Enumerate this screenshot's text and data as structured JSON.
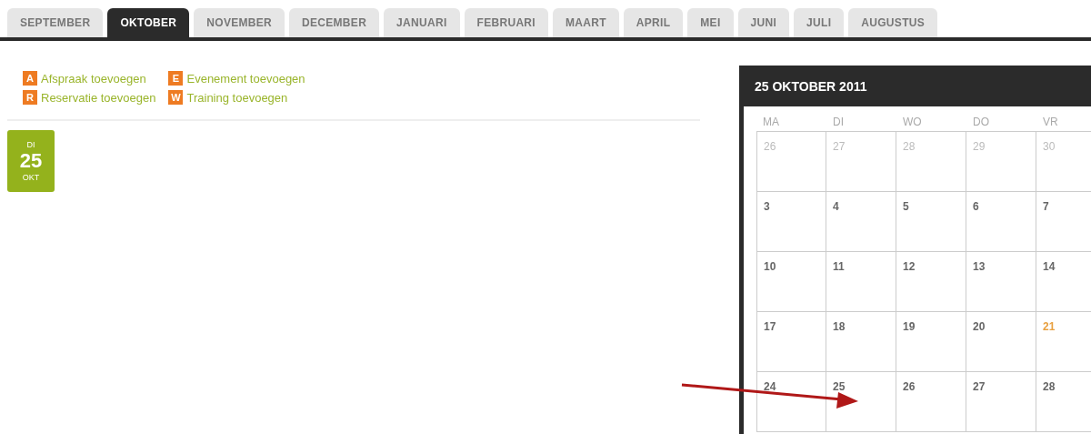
{
  "tabs": [
    {
      "label": "SEPTEMBER",
      "selected": false
    },
    {
      "label": "OKTOBER",
      "selected": true
    },
    {
      "label": "NOVEMBER",
      "selected": false
    },
    {
      "label": "DECEMBER",
      "selected": false
    },
    {
      "label": "JANUARI",
      "selected": false
    },
    {
      "label": "FEBRUARI",
      "selected": false
    },
    {
      "label": "MAART",
      "selected": false
    },
    {
      "label": "APRIL",
      "selected": false
    },
    {
      "label": "MEI",
      "selected": false
    },
    {
      "label": "JUNI",
      "selected": false
    },
    {
      "label": "JULI",
      "selected": false
    },
    {
      "label": "AUGUSTUS",
      "selected": false
    }
  ],
  "actions": [
    {
      "key": "A",
      "label": "Afspraak toevoegen"
    },
    {
      "key": "E",
      "label": "Evenement toevoegen"
    },
    {
      "key": "R",
      "label": "Reservatie toevoegen"
    },
    {
      "key": "W",
      "label": "Training toevoegen"
    }
  ],
  "date_badge": {
    "weekday": "DI",
    "day": "25",
    "month": "OKT"
  },
  "calendar": {
    "title": "25 OKTOBER 2011",
    "weekdays": [
      "MA",
      "DI",
      "WO",
      "DO",
      "VR"
    ],
    "weeks": [
      [
        {
          "day": "26",
          "kind": "outside"
        },
        {
          "day": "27",
          "kind": "outside"
        },
        {
          "day": "28",
          "kind": "outside"
        },
        {
          "day": "29",
          "kind": "outside"
        },
        {
          "day": "30",
          "kind": "outside"
        }
      ],
      [
        {
          "day": "3",
          "kind": "day"
        },
        {
          "day": "4",
          "kind": "day"
        },
        {
          "day": "5",
          "kind": "day"
        },
        {
          "day": "6",
          "kind": "day"
        },
        {
          "day": "7",
          "kind": "day"
        }
      ],
      [
        {
          "day": "10",
          "kind": "day"
        },
        {
          "day": "11",
          "kind": "day"
        },
        {
          "day": "12",
          "kind": "day"
        },
        {
          "day": "13",
          "kind": "day"
        },
        {
          "day": "14",
          "kind": "day"
        }
      ],
      [
        {
          "day": "17",
          "kind": "day"
        },
        {
          "day": "18",
          "kind": "day"
        },
        {
          "day": "19",
          "kind": "day"
        },
        {
          "day": "20",
          "kind": "day"
        },
        {
          "day": "21",
          "kind": "special"
        }
      ],
      [
        {
          "day": "24",
          "kind": "day"
        },
        {
          "day": "25",
          "kind": "day"
        },
        {
          "day": "26",
          "kind": "day"
        },
        {
          "day": "27",
          "kind": "day"
        },
        {
          "day": "28",
          "kind": "day"
        }
      ]
    ]
  }
}
